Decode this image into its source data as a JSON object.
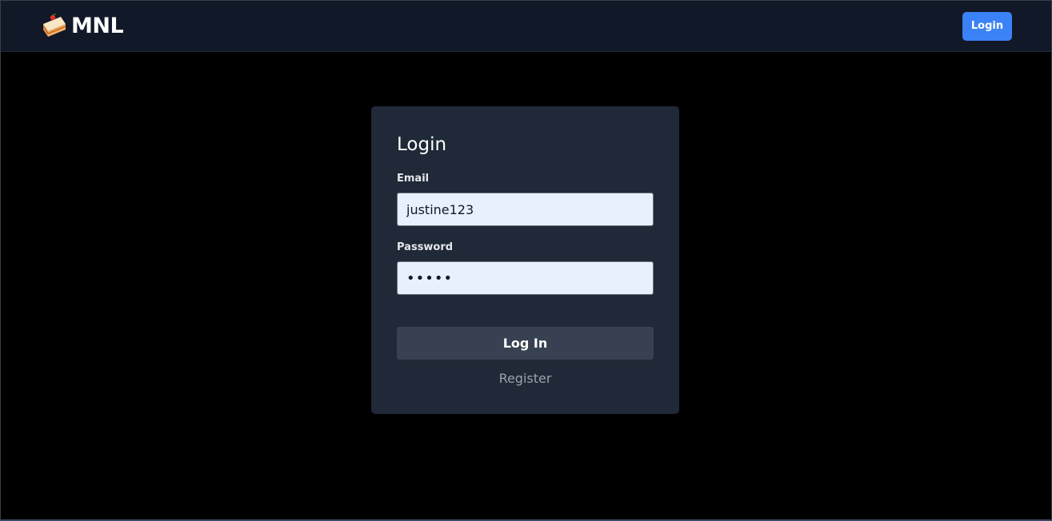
{
  "navbar": {
    "brand_icon": "cake-slice-icon",
    "brand_name": "MNL",
    "login_label": "Login",
    "login_color": "#3b82f6",
    "background": "#111827"
  },
  "login_form": {
    "title": "Login",
    "email_label": "Email",
    "email_value": "justine123",
    "password_label": "Password",
    "password_value": "•••••",
    "submit_label": "Log In",
    "register_label": "Register",
    "card_color": "#1f2937",
    "input_color": "#e8f0fe"
  }
}
